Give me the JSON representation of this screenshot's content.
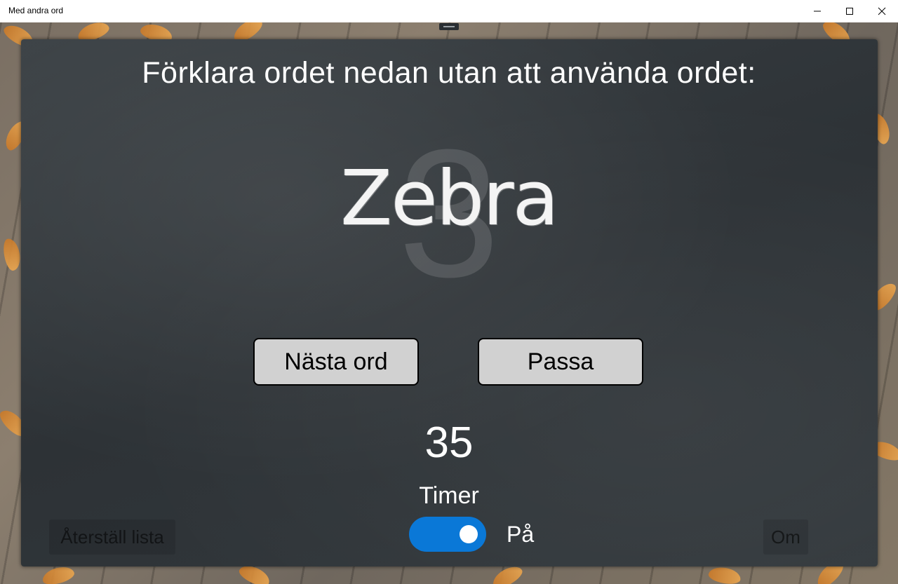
{
  "window": {
    "title": "Med andra ord",
    "controls": [
      "minimize-icon",
      "maximize-icon",
      "close-icon"
    ]
  },
  "game": {
    "instruction": "Förklara ordet nedan utan att använda ordet:",
    "word": "Zebra",
    "countdown_overlay": "3",
    "next_button": "Nästa ord",
    "pass_button": "Passa",
    "seconds_remaining": "35",
    "timer_label": "Timer",
    "timer_toggle_on": true,
    "timer_state": "På",
    "reset_button": "Återställ lista",
    "about_button": "Om"
  },
  "colors": {
    "toggle_accent": "#0a78d7",
    "button_fill": "#d1d1d1",
    "board": "#2d3236"
  }
}
